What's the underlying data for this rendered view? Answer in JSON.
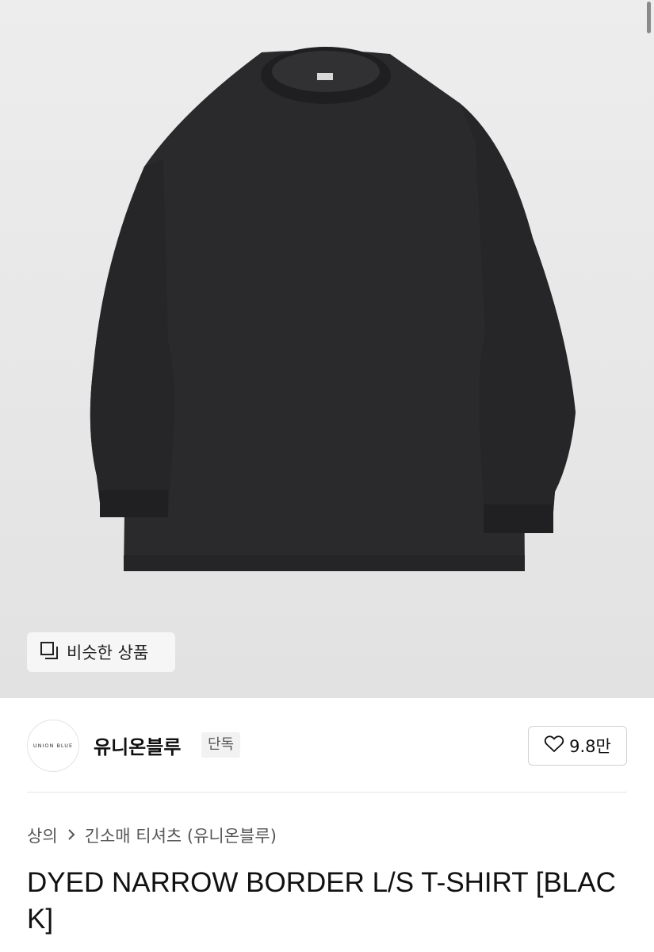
{
  "similar_products": {
    "label": "비슷한 상품"
  },
  "brand": {
    "logo_text": "UNION BLUE",
    "name": "유니온블루",
    "badge": "단독"
  },
  "likes": {
    "count": "9.8만"
  },
  "breadcrumb": {
    "level1": "상의",
    "separator": ">",
    "level2": "긴소매 티셔츠 (유니온블루)"
  },
  "product": {
    "title": "DYED NARROW BORDER L/S T-SHIRT [BLACK]"
  },
  "colors": {
    "shirt": "#2a2a2c",
    "background": "#e6e6e6"
  },
  "icons": {
    "similar": "copy-icon",
    "like": "heart-icon",
    "breadcrumb_sep": "chevron-right-icon"
  }
}
